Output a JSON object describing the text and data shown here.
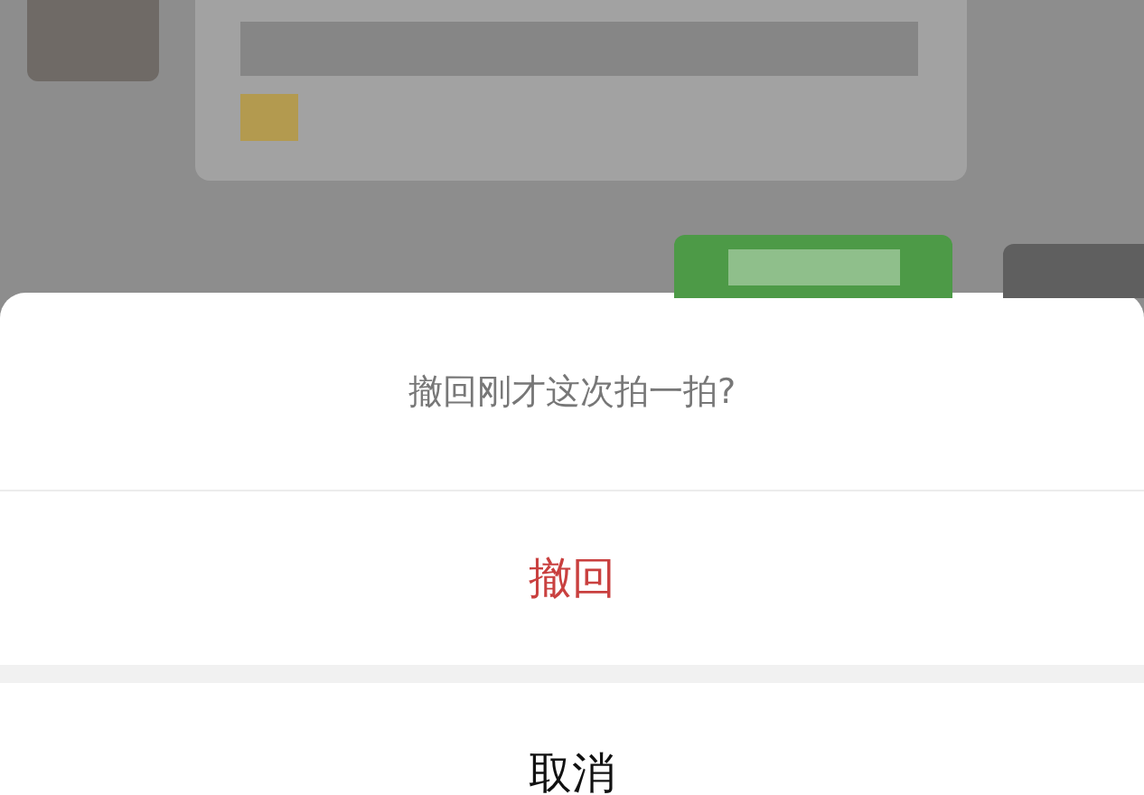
{
  "chat": {
    "messages": [
      {
        "kind": "incoming"
      },
      {
        "kind": "outgoing"
      }
    ]
  },
  "action_sheet": {
    "title": "撤回刚才这次拍一拍?",
    "actions": [
      {
        "label": "撤回",
        "kind": "destructive"
      }
    ],
    "cancel": {
      "label": "取消"
    }
  }
}
